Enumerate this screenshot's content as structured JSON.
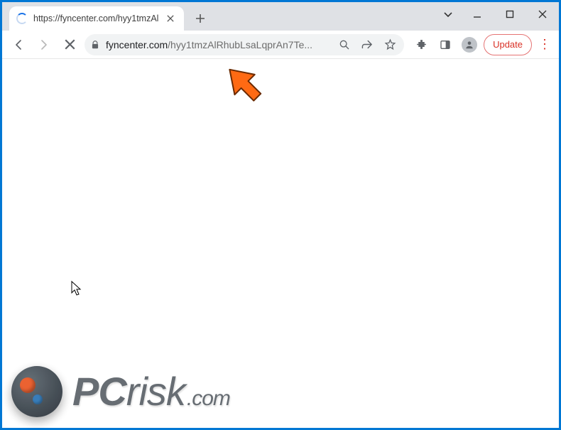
{
  "tab": {
    "title": "https://fyncenter.com/hyy1tmzAl"
  },
  "url": {
    "host": "fyncenter.com",
    "path": "/hyy1tmzAlRhubLsaLqprAn7Te..."
  },
  "toolbar": {
    "update_label": "Update"
  },
  "watermark": {
    "brand_bold": "PC",
    "brand_rest": "risk",
    "tld": ".com"
  }
}
